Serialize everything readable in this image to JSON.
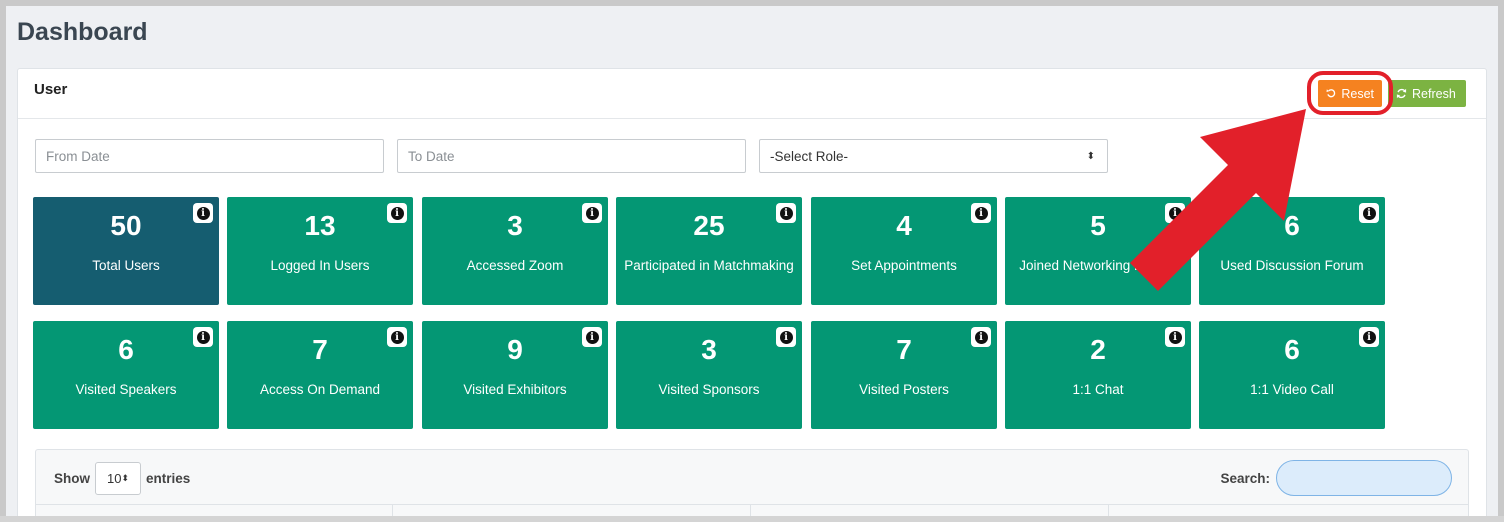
{
  "page": {
    "title": "Dashboard"
  },
  "card": {
    "title": "User",
    "reset_label": "Reset",
    "refresh_label": "Refresh"
  },
  "filters": {
    "from_placeholder": "From Date",
    "to_placeholder": "To Date",
    "role_selected": "-Select Role-"
  },
  "tiles": [
    {
      "value": "50",
      "label": "Total Users",
      "style": "dark"
    },
    {
      "value": "13",
      "label": "Logged In Users"
    },
    {
      "value": "3",
      "label": "Accessed Zoom"
    },
    {
      "value": "25",
      "label": "Participated in Matchmaking"
    },
    {
      "value": "4",
      "label": "Set Appointments"
    },
    {
      "value": "5",
      "label": "Joined Networking Rooms"
    },
    {
      "value": "6",
      "label": "Used Discussion Forum"
    },
    {
      "value": "6",
      "label": "Visited Speakers"
    },
    {
      "value": "7",
      "label": "Access On Demand"
    },
    {
      "value": "9",
      "label": "Visited Exhibitors"
    },
    {
      "value": "3",
      "label": "Visited Sponsors"
    },
    {
      "value": "7",
      "label": "Visited Posters"
    },
    {
      "value": "2",
      "label": "1:1 Chat"
    },
    {
      "value": "6",
      "label": "1:1 Video Call"
    }
  ],
  "table": {
    "show_label": "Show",
    "length_value": "10",
    "entries_label": "entries",
    "search_label": "Search:"
  },
  "colors": {
    "tile_green": "#049774",
    "tile_dark": "#155d70",
    "reset_orange": "#f58220",
    "refresh_green": "#7cb342",
    "annotation_red": "#e2202a"
  }
}
